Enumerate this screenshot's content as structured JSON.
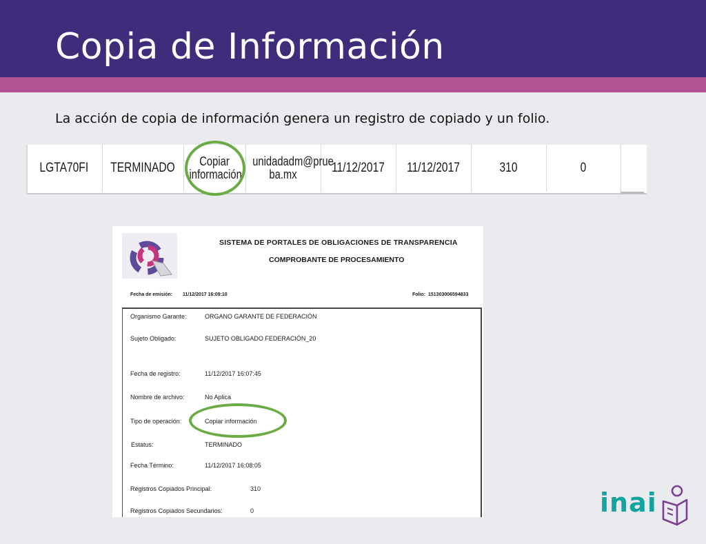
{
  "slide": {
    "title": "Copia de Información",
    "subtitle": "La acción de copia de información genera un registro de copiado y un folio."
  },
  "record_row": {
    "cells": [
      "LGTA70FI",
      "TERMINADO",
      "Copiar\ninformación",
      "unidadadm@prue\nba.mx",
      "11/12/2017",
      "11/12/2017",
      "310",
      "0"
    ]
  },
  "receipt": {
    "header_line1": "SISTEMA DE PORTALES DE OBLIGACIONES DE TRANSPARENCIA",
    "header_line2": "COMPROBANTE DE PROCESAMIENTO",
    "issue_label": "Fecha de emisión:",
    "issue_value": "11/12/2017 16:09:10",
    "folio_label": "Folio:",
    "folio_value": "151303006594833",
    "fields": [
      {
        "label": "Organismo Garante:",
        "value": "ORGANO GARANTE DE FEDERACIÓN"
      },
      {
        "label": "Sujeto Obligado:",
        "value": "SUJETO OBLIGADO FEDERACIÓN_20"
      },
      {
        "label": "Fecha de registro:",
        "value": "11/12/2017 16:07:45"
      },
      {
        "label": "Nombre  de archivo:",
        "value": "No Aplica"
      },
      {
        "label": "Tipo de operación:",
        "value": "Copiar información"
      },
      {
        "label": "Estatus:",
        "value": "TERMINADO"
      },
      {
        "label": "Fecha Término:",
        "value": "11/12/2017 16:08:05"
      },
      {
        "label": "Registros Copiados Principal:",
        "value": "310"
      },
      {
        "label": "Registros Copiados Secundarios:",
        "value": "0"
      }
    ]
  },
  "brand": {
    "wordmark": "inai",
    "color_primary": "#3f2d7c",
    "color_accent": "#b45394",
    "color_highlight": "#6aab45",
    "color_brand": "#15a3a0",
    "icon": "inai-reader-icon"
  }
}
